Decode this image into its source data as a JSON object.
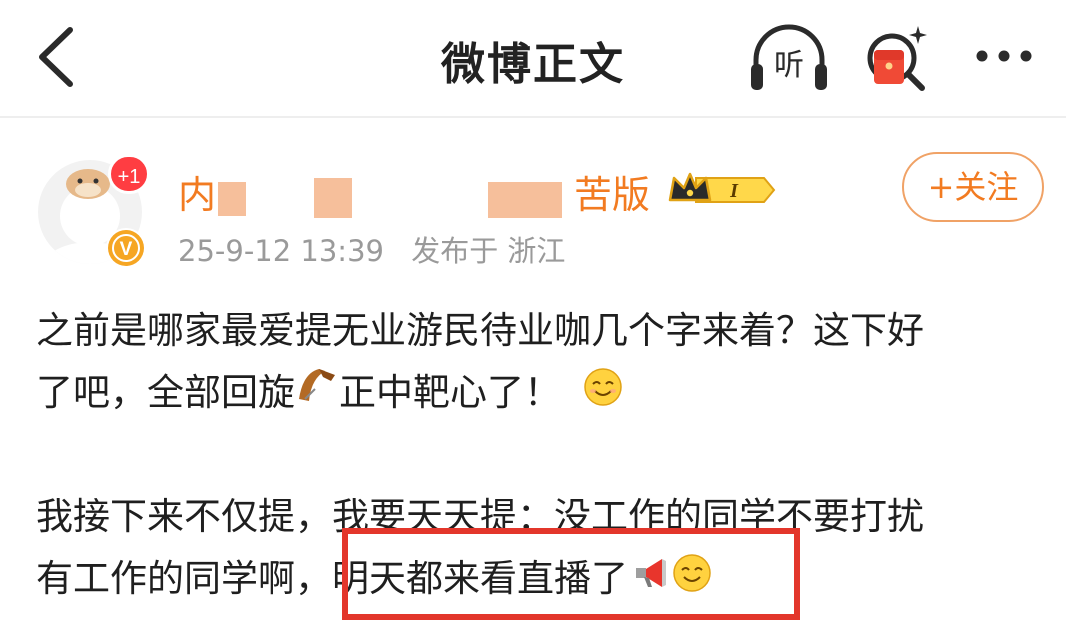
{
  "header": {
    "title": "微博正文",
    "listen_label": "听"
  },
  "author": {
    "name_start": "内",
    "name_end": "苦版",
    "member_level": "I",
    "unread_badge": "+1",
    "verified_mark": "V",
    "follow_label": "+关注"
  },
  "post": {
    "date": "25-9-12 13:39",
    "location": "发布于 浙江",
    "line1": "之前是哪家最爱提无业游民待业咖几个字来着？这下好",
    "line2a": "了吧，全部回旋",
    "line2b": "正中靶心了！",
    "line3": "我接下来不仅提，我要天天提：没工作的同学不要打扰",
    "line4a": "有工作的同学啊，",
    "line4b": "明天都来看直播了"
  },
  "colors": {
    "accent": "#f27b21",
    "highlight_border": "#e3362b",
    "meta_text": "#9a9a9a"
  },
  "icons": [
    "back-arrow-icon",
    "headphones-icon",
    "search-redpacket-icon",
    "more-dots-icon",
    "boomerang-emoji",
    "smile-emoji",
    "megaphone-emoji",
    "crown-icon",
    "verified-icon"
  ]
}
